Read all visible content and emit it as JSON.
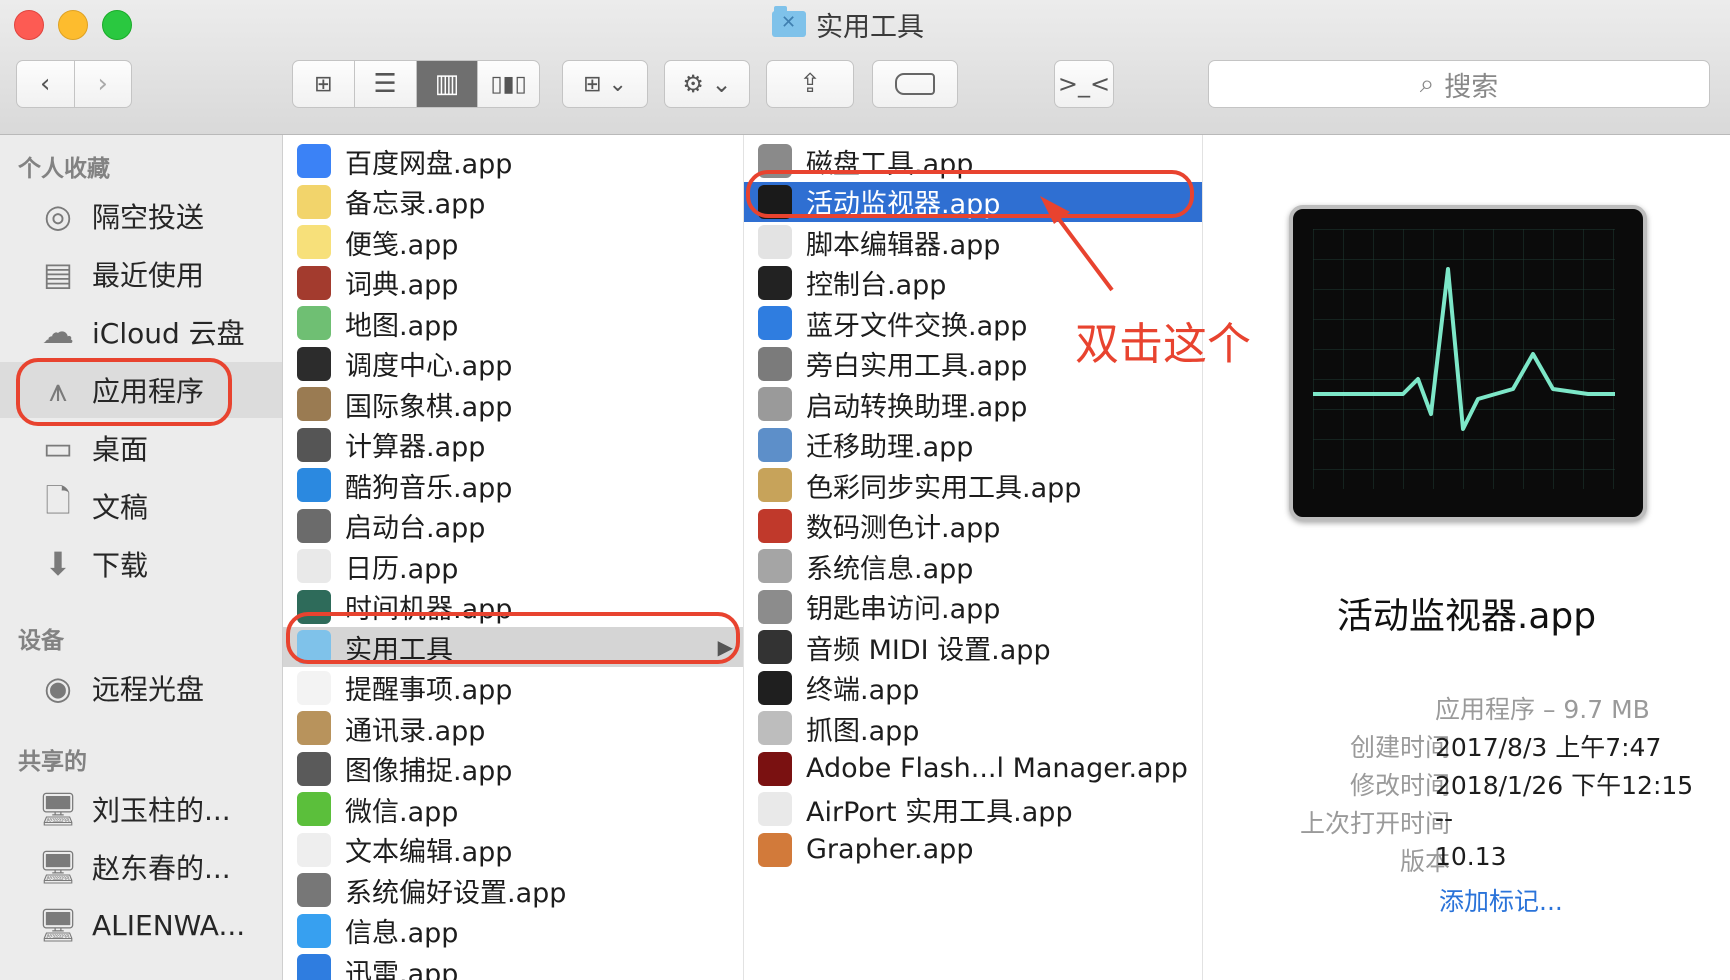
{
  "window": {
    "title": "实用工具"
  },
  "toolbar": {
    "back_icon": "chevron-left-icon",
    "forward_icon": "chevron-right-icon",
    "view_icons": [
      "icon-view-icon",
      "list-view-icon",
      "column-view-icon",
      "cover-flow-icon"
    ],
    "search_placeholder": "搜索"
  },
  "sidebar": {
    "sections": [
      {
        "title": "个人收藏",
        "items": [
          {
            "label": "隔空投送",
            "icon": "airdrop-icon"
          },
          {
            "label": "最近使用",
            "icon": "recents-icon"
          },
          {
            "label": "iCloud 云盘",
            "icon": "cloud-icon"
          },
          {
            "label": "应用程序",
            "icon": "applications-icon"
          },
          {
            "label": "桌面",
            "icon": "desktop-icon"
          },
          {
            "label": "文稿",
            "icon": "documents-icon"
          },
          {
            "label": "下载",
            "icon": "downloads-icon"
          }
        ]
      },
      {
        "title": "设备",
        "items": [
          {
            "label": "远程光盘",
            "icon": "disc-icon"
          }
        ]
      },
      {
        "title": "共享的",
        "items": [
          {
            "label": "刘玉柱的...",
            "icon": "computer-icon"
          },
          {
            "label": "赵东春的...",
            "icon": "computer-icon"
          },
          {
            "label": "ALIENWA...",
            "icon": "computer-icon"
          }
        ]
      }
    ]
  },
  "column1": [
    {
      "label": "百度网盘.app",
      "color": "#3b82f6"
    },
    {
      "label": "备忘录.app",
      "color": "#f2d46b"
    },
    {
      "label": "便笺.app",
      "color": "#f7e07a"
    },
    {
      "label": "词典.app",
      "color": "#a33b2e"
    },
    {
      "label": "地图.app",
      "color": "#6fbf73"
    },
    {
      "label": "调度中心.app",
      "color": "#2c2c2c"
    },
    {
      "label": "国际象棋.app",
      "color": "#9a7b52"
    },
    {
      "label": "计算器.app",
      "color": "#555555"
    },
    {
      "label": "酷狗音乐.app",
      "color": "#2b89e0"
    },
    {
      "label": "启动台.app",
      "color": "#6b6b6b"
    },
    {
      "label": "日历.app",
      "color": "#e9e9e9"
    },
    {
      "label": "时间机器.app",
      "color": "#2e6b5a"
    },
    {
      "label": "实用工具",
      "color": "#7fc2ea"
    },
    {
      "label": "提醒事项.app",
      "color": "#f3f3f3"
    },
    {
      "label": "通讯录.app",
      "color": "#b8935c"
    },
    {
      "label": "图像捕捉.app",
      "color": "#5a5a5a"
    },
    {
      "label": "微信.app",
      "color": "#5bbf3b"
    },
    {
      "label": "文本编辑.app",
      "color": "#eeeeee"
    },
    {
      "label": "系统偏好设置.app",
      "color": "#777777"
    },
    {
      "label": "信息.app",
      "color": "#37a0f0"
    },
    {
      "label": "迅雷.app",
      "color": "#2f7de0"
    }
  ],
  "column2": [
    {
      "label": "磁盘工具.app",
      "color": "#8a8a8a"
    },
    {
      "label": "活动监视器.app",
      "color": "#1a1a1a"
    },
    {
      "label": "脚本编辑器.app",
      "color": "#e3e3e3"
    },
    {
      "label": "控制台.app",
      "color": "#222222"
    },
    {
      "label": "蓝牙文件交换.app",
      "color": "#2f7de0"
    },
    {
      "label": "旁白实用工具.app",
      "color": "#7b7b7b"
    },
    {
      "label": "启动转换助理.app",
      "color": "#9a9a9a"
    },
    {
      "label": "迁移助理.app",
      "color": "#5d8fc9"
    },
    {
      "label": "色彩同步实用工具.app",
      "color": "#c7a35a"
    },
    {
      "label": "数码测色计.app",
      "color": "#c0392b"
    },
    {
      "label": "系统信息.app",
      "color": "#a5a5a5"
    },
    {
      "label": "钥匙串访问.app",
      "color": "#8c8c8c"
    },
    {
      "label": "音频 MIDI 设置.app",
      "color": "#333333"
    },
    {
      "label": "终端.app",
      "color": "#1f1f1f"
    },
    {
      "label": "抓图.app",
      "color": "#bdbdbd"
    },
    {
      "label": "Adobe Flash...l Manager.app",
      "color": "#7a1111"
    },
    {
      "label": "AirPort 实用工具.app",
      "color": "#e9e9e9"
    },
    {
      "label": "Grapher.app",
      "color": "#d27a3a"
    }
  ],
  "preview": {
    "name": "活动监视器.app",
    "kind": "应用程序 – 9.7 MB",
    "created_label": "创建时间",
    "created": "2017/8/3 上午7:47",
    "modified_label": "修改时间",
    "modified": "2018/1/26 下午12:15",
    "opened_label": "上次打开时间",
    "opened": "--",
    "version_label": "版本",
    "version": "10.13",
    "add_tags": "添加标记..."
  },
  "annotation": {
    "note": "双击这个",
    "color": "#e8432f"
  }
}
